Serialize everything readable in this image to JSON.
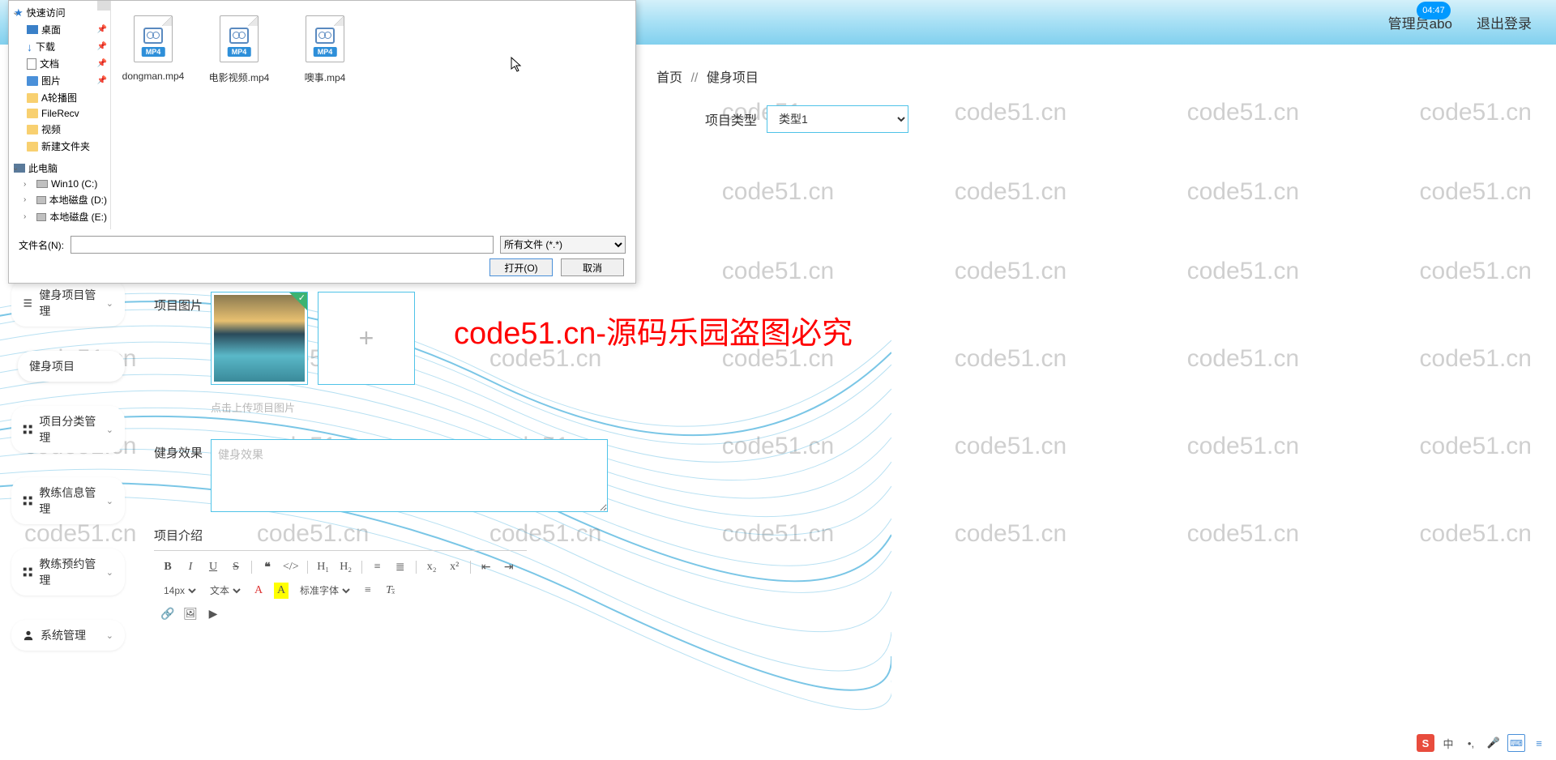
{
  "header": {
    "admin": "管理员abo",
    "logout": "退出登录",
    "time": "04:47"
  },
  "breadcrumb": {
    "home": "首页",
    "sep": "//",
    "current": "健身项目"
  },
  "project_type": {
    "label": "项目类型",
    "selected": "类型1"
  },
  "sidebar": {
    "items": [
      {
        "label": "健身项目管理",
        "icon": "list"
      },
      {
        "label": "健身项目",
        "sub": true
      },
      {
        "label": "项目分类管理",
        "icon": "grid"
      },
      {
        "label": "教练信息管理",
        "icon": "grid"
      },
      {
        "label": "教练预约管理",
        "icon": "grid"
      },
      {
        "label": "系统管理",
        "icon": "user"
      }
    ]
  },
  "form": {
    "image_label": "项目图片",
    "image_hint": "点击上传项目图片",
    "effect_label": "健身效果",
    "effect_placeholder": "健身效果",
    "intro_label": "项目介绍"
  },
  "editor": {
    "font_size": "14px",
    "font_type": "文本",
    "font_family": "标准字体"
  },
  "file_dialog": {
    "tree": {
      "quick": "快速访问",
      "desktop": "桌面",
      "downloads": "下载",
      "docs": "文档",
      "pics": "图片",
      "f1": "A轮播图",
      "f2": "FileRecv",
      "f3": "视频",
      "f4": "新建文件夹",
      "pc": "此电脑",
      "d1": "Win10 (C:)",
      "d2": "本地磁盘 (D:)",
      "d3": "本地磁盘 (E:)"
    },
    "files": [
      {
        "name": "dongman.mp4",
        "badge": "MP4"
      },
      {
        "name": "电影视频.mp4",
        "badge": "MP4"
      },
      {
        "name": "噢事.mp4",
        "badge": "MP4"
      }
    ],
    "filename_label": "文件名(N):",
    "filter": "所有文件 (*.*)",
    "open": "打开(O)",
    "cancel": "取消"
  },
  "watermark": {
    "text": "code51.cn",
    "center": "code51.cn-源码乐园盗图必究"
  },
  "ime": {
    "logo": "S",
    "lang": "中"
  }
}
